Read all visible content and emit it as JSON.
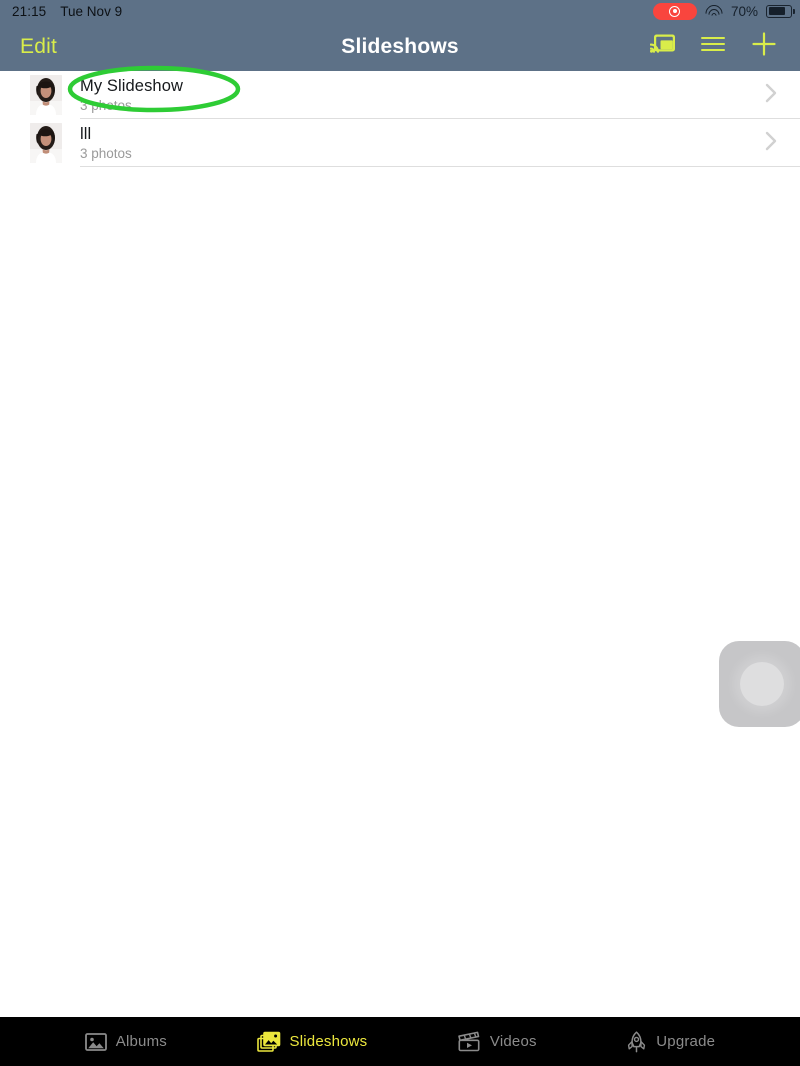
{
  "status_bar": {
    "time": "21:15",
    "date": "Tue Nov 9",
    "recording_icon": "record-circle-icon",
    "wifi_icon": "wifi-icon",
    "battery_percent": "70%",
    "battery_icon": "battery-icon",
    "background_color": "#5d7187"
  },
  "nav_bar": {
    "edit_label": "Edit",
    "title": "Slideshows",
    "cast_icon": "chromecast-icon",
    "menu_icon": "hamburger-menu-icon",
    "add_icon": "plus-icon",
    "tint_color": "#d9ed4a",
    "background_color": "#5d7187"
  },
  "list": {
    "rows": [
      {
        "title": "My Slideshow",
        "subtitle": "3 photos",
        "thumbnail": "portrait-photo-thumbnail",
        "chevron": "chevron-right-icon"
      },
      {
        "title": "lll",
        "subtitle": "3 photos",
        "thumbnail": "portrait-photo-thumbnail",
        "chevron": "chevron-right-icon"
      }
    ]
  },
  "annotation": {
    "shape": "ellipse-highlight",
    "target": "My Slideshow",
    "color": "#2ecc35"
  },
  "assistive_touch": {
    "icon": "assistive-touch-button"
  },
  "tab_bar": {
    "background_color": "#000000",
    "active_color": "#ece73d",
    "inactive_color": "#8b8b8b",
    "tabs": [
      {
        "label": "Albums",
        "icon": "photo-album-icon",
        "active": false
      },
      {
        "label": "Slideshows",
        "icon": "stacked-photos-icon",
        "active": true
      },
      {
        "label": "Videos",
        "icon": "clapperboard-icon",
        "active": false
      },
      {
        "label": "Upgrade",
        "icon": "rocket-icon",
        "active": false
      }
    ]
  }
}
